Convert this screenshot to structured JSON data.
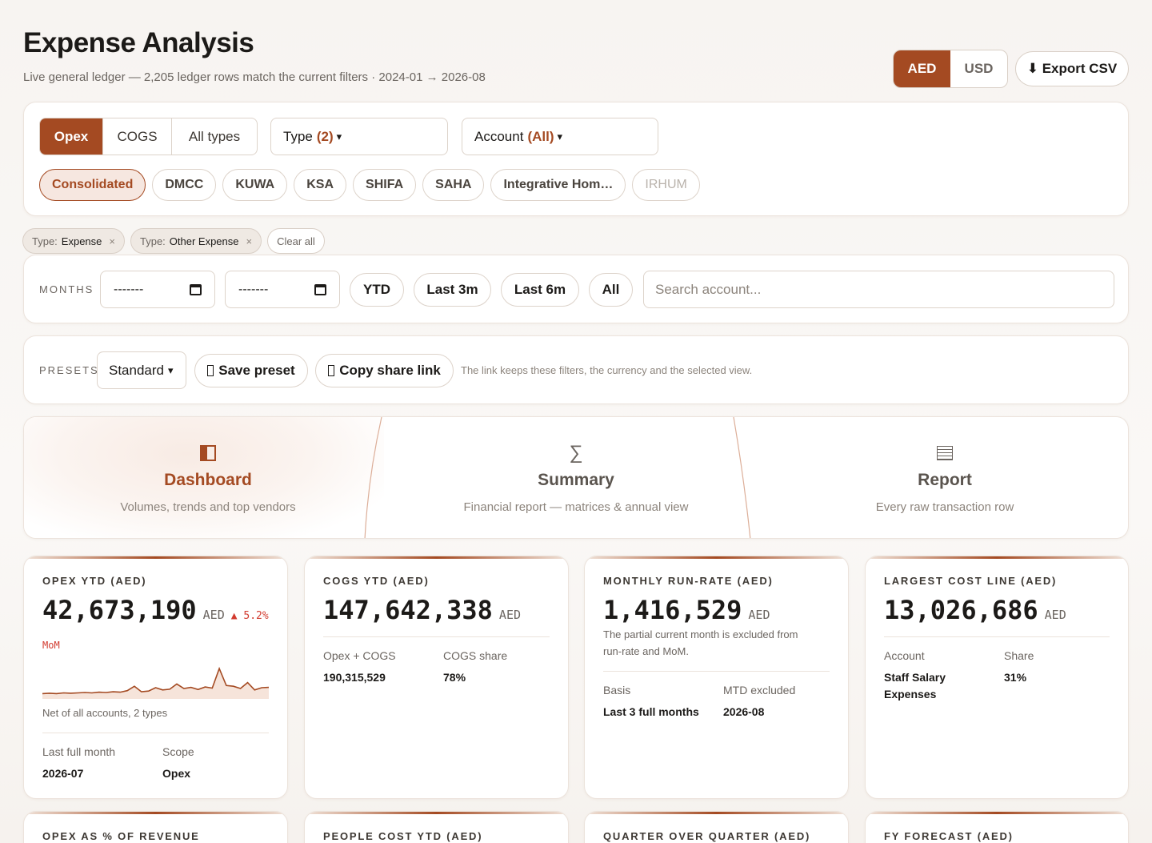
{
  "header": {
    "title": "Expense Analysis",
    "subtitle": "Live general ledger — 2,205 ledger rows match the current filters · 2024-01 → 2026-08"
  },
  "currency": {
    "options": [
      "AED",
      "USD"
    ],
    "selected": "AED"
  },
  "export": {
    "icon": "download-icon",
    "label": "⬇ Export CSV"
  },
  "filters": {
    "cost_types": [
      "Opex",
      "COGS",
      "All types"
    ],
    "selected_cost_type": "Opex",
    "type_dropdown": {
      "label": "Type",
      "value": "(2)",
      "caret": "▾"
    },
    "account_dropdown": {
      "label": "Account",
      "value": "(All)",
      "caret": "▾"
    },
    "entities": [
      "Consolidated",
      "DMCC",
      "KUWA",
      "KSA",
      "SHIFA",
      "SAHA",
      "Integrative Hom…",
      "IRHUM"
    ],
    "selected_entity": "Consolidated",
    "disabled_entity": "IRHUM"
  },
  "active_chips": [
    {
      "key": "Type:",
      "value": "Expense",
      "remove": "×"
    },
    {
      "key": "Type:",
      "value": "Other Expense",
      "remove": "×"
    }
  ],
  "clear_all": "Clear all",
  "months": {
    "label": "MONTHS",
    "from_placeholder": "-------",
    "to_placeholder": "-------",
    "quick": [
      "YTD",
      "Last 3m",
      "Last 6m",
      "All"
    ],
    "search_placeholder": "Search account..."
  },
  "presets": {
    "label": "PRESETS",
    "selected": "Standard",
    "caret": "▾",
    "save_label": "Save preset",
    "copy_label": "Copy share link",
    "hint": "The link keeps these filters, the currency and the selected view."
  },
  "views": [
    {
      "icon": "dashboard-icon",
      "title": "Dashboard",
      "desc": "Volumes, trends and top vendors"
    },
    {
      "icon": "sigma-icon",
      "glyph": "∑",
      "title": "Summary",
      "desc": "Financial report — matrices & annual view"
    },
    {
      "icon": "report-icon",
      "title": "Report",
      "desc": "Every raw transaction row"
    }
  ],
  "selected_view": "Dashboard",
  "kpis": {
    "opex_ytd": {
      "label": "OPEX YTD (AED)",
      "value": "42,673,190",
      "unit": "AED",
      "delta": "▲ 5.2%",
      "delta_suffix": "MoM",
      "sparkline_caption": "Net of all accounts, 2 types",
      "sparkline": [
        0.1,
        0.11,
        0.1,
        0.12,
        0.11,
        0.12,
        0.13,
        0.12,
        0.14,
        0.13,
        0.15,
        0.14,
        0.18,
        0.3,
        0.15,
        0.17,
        0.26,
        0.2,
        0.22,
        0.36,
        0.24,
        0.27,
        0.21,
        0.28,
        0.25,
        0.78,
        0.32,
        0.3,
        0.24,
        0.4,
        0.2,
        0.26,
        0.27
      ],
      "meta": [
        {
          "label": "Last full month",
          "value": "2026-07"
        },
        {
          "label": "Scope",
          "value": "Opex"
        }
      ]
    },
    "cogs_ytd": {
      "label": "COGS YTD (AED)",
      "value": "147,642,338",
      "unit": "AED",
      "meta": [
        {
          "label": "Opex + COGS",
          "value": "190,315,529"
        },
        {
          "label": "COGS share",
          "value": "78%"
        }
      ]
    },
    "run_rate": {
      "label": "MONTHLY RUN-RATE (AED)",
      "value": "1,416,529",
      "unit": "AED",
      "note": "The partial current month is excluded from run-rate and MoM.",
      "meta": [
        {
          "label": "Basis",
          "value": "Last 3 full months"
        },
        {
          "label": "MTD excluded",
          "value": "2026-08"
        }
      ]
    },
    "largest_cost": {
      "label": "LARGEST COST LINE (AED)",
      "value": "13,026,686",
      "unit": "AED",
      "meta": [
        {
          "label": "Account",
          "value": "Staff Salary Expenses"
        },
        {
          "label": "Share",
          "value": "31%"
        }
      ]
    }
  },
  "kpis_row2": [
    "OPEX AS % OF REVENUE",
    "PEOPLE COST YTD (AED)",
    "QUARTER OVER QUARTER (AED)",
    "FY FORECAST (AED)"
  ],
  "colors": {
    "accent": "#a44a22",
    "negative": "#d23b2f",
    "sparkline_fill": "#f6e4da"
  }
}
